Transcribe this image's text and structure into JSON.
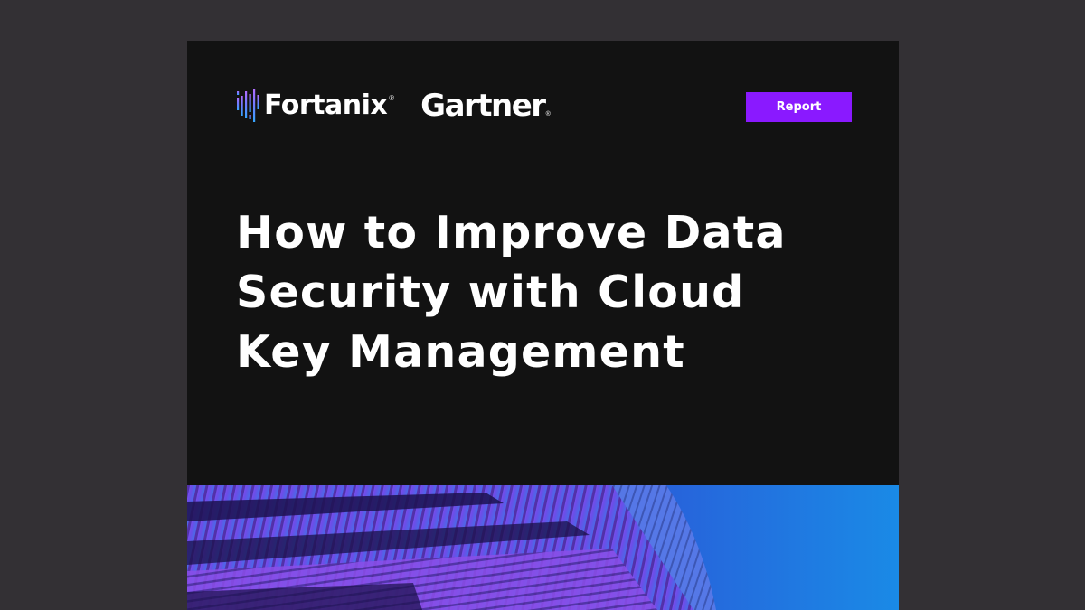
{
  "brand": {
    "fortanix": "Fortanix",
    "gartner": "Gartner",
    "registered_mark": "®"
  },
  "badge": {
    "label": "Report"
  },
  "document": {
    "title_lines": [
      "How to Improve Data",
      "Security with Cloud",
      "Key Management"
    ]
  },
  "colors": {
    "background": "#333034",
    "cover": "#121212",
    "accent_purple": "#8a19ff",
    "accent_blue": "#1f86e3"
  },
  "icons": {
    "fortanix_logo": "fortanix-logo-icon"
  }
}
